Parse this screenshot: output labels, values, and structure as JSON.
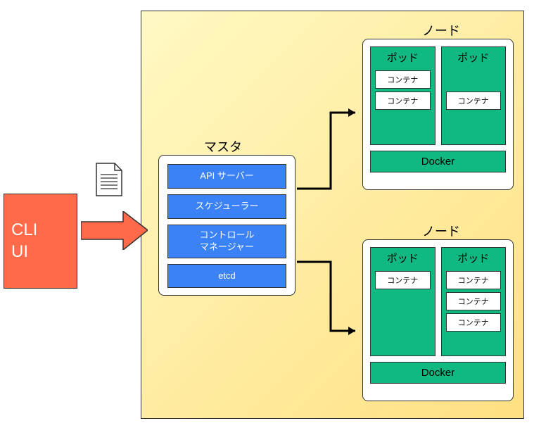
{
  "cli": {
    "line1": "CLI",
    "line2": "UI"
  },
  "master": {
    "label": "マスタ",
    "api": "API サーバー",
    "scheduler": "スケジューラー",
    "controller_line1": "コントロール",
    "controller_line2": "マネージャー",
    "etcd": "etcd"
  },
  "node1": {
    "label": "ノード",
    "pod1": {
      "label": "ポッド",
      "c1": "コンテナ",
      "c2": "コンテナ"
    },
    "pod2": {
      "label": "ポッド",
      "c1": "コンテナ"
    },
    "docker": "Docker"
  },
  "node2": {
    "label": "ノード",
    "pod1": {
      "label": "ポッド",
      "c1": "コンテナ"
    },
    "pod2": {
      "label": "ポッド",
      "c1": "コンテナ",
      "c2": "コンテナ",
      "c3": "コンテナ"
    },
    "docker": "Docker"
  }
}
